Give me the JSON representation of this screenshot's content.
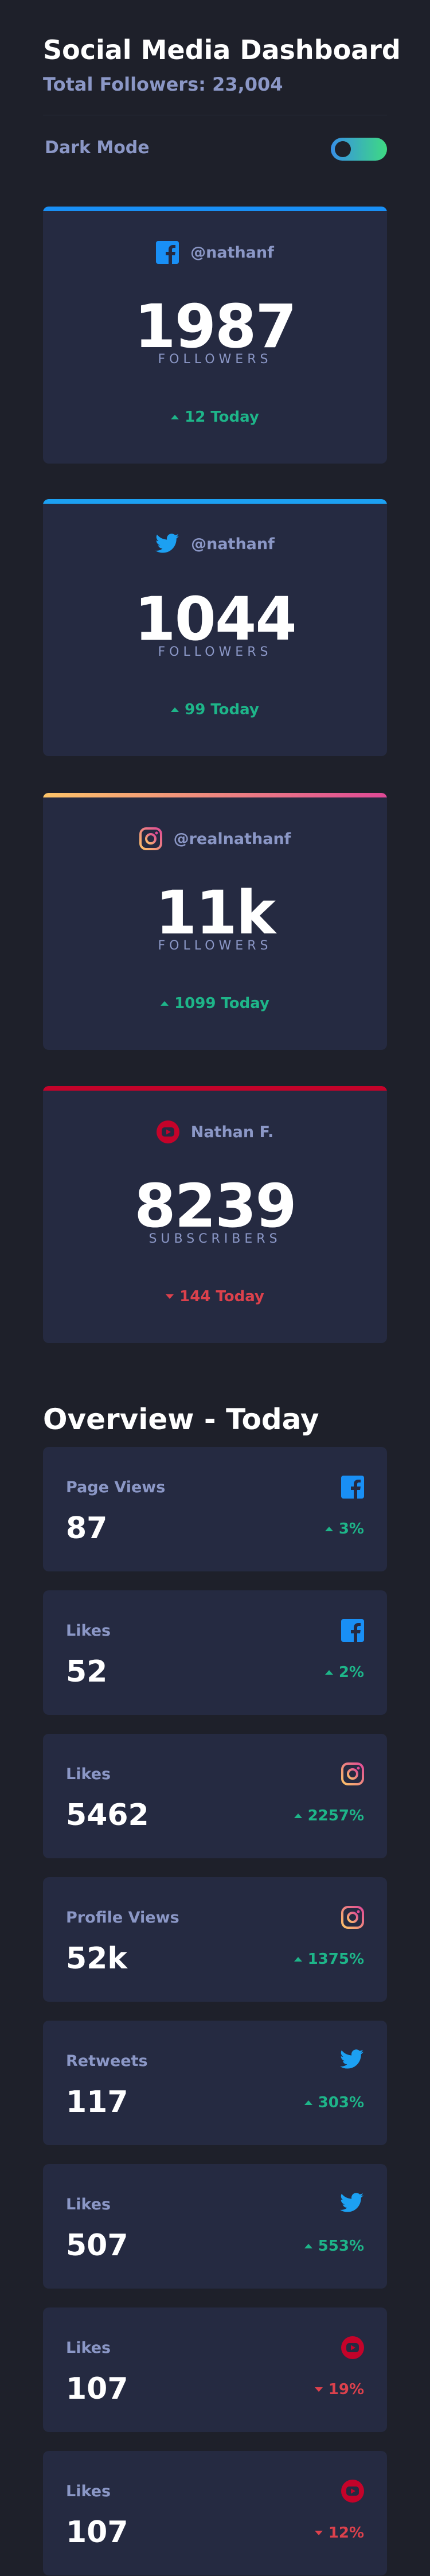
{
  "header": {
    "title": "Social Media Dashboard",
    "total_followers": "Total Followers: 23,004",
    "dark_mode_label": "Dark Mode",
    "dark_mode_on": true
  },
  "colors": {
    "facebook": "#198ff5",
    "twitter": "#1ca0f2",
    "youtube": "#c4032a",
    "up": "#1eb589",
    "down": "#dc414c"
  },
  "cards": [
    {
      "platform": "facebook",
      "icon": "facebook-icon",
      "handle": "@nathanf",
      "count": "1987",
      "unit": "FOLLOWERS",
      "trend": "up",
      "change": "12 Today"
    },
    {
      "platform": "twitter",
      "icon": "twitter-icon",
      "handle": "@nathanf",
      "count": "1044",
      "unit": "FOLLOWERS",
      "trend": "up",
      "change": "99 Today"
    },
    {
      "platform": "instagram",
      "icon": "instagram-icon",
      "handle": "@realnathanf",
      "count": "11k",
      "unit": "FOLLOWERS",
      "trend": "up",
      "change": "1099 Today"
    },
    {
      "platform": "youtube",
      "icon": "youtube-icon",
      "handle": "Nathan F.",
      "count": "8239",
      "unit": "SUBSCRIBERS",
      "trend": "down",
      "change": "144 Today"
    }
  ],
  "overview": {
    "title": "Overview - Today",
    "items": [
      {
        "label": "Page Views",
        "platform": "facebook",
        "icon": "facebook-icon",
        "value": "87",
        "trend": "up",
        "pct": "3%"
      },
      {
        "label": "Likes",
        "platform": "facebook",
        "icon": "facebook-icon",
        "value": "52",
        "trend": "up",
        "pct": "2%"
      },
      {
        "label": "Likes",
        "platform": "instagram",
        "icon": "instagram-icon",
        "value": "5462",
        "trend": "up",
        "pct": "2257%"
      },
      {
        "label": "Profile Views",
        "platform": "instagram",
        "icon": "instagram-icon",
        "value": "52k",
        "trend": "up",
        "pct": "1375%"
      },
      {
        "label": "Retweets",
        "platform": "twitter",
        "icon": "twitter-icon",
        "value": "117",
        "trend": "up",
        "pct": "303%"
      },
      {
        "label": "Likes",
        "platform": "twitter",
        "icon": "twitter-icon",
        "value": "507",
        "trend": "up",
        "pct": "553%"
      },
      {
        "label": "Likes",
        "platform": "youtube",
        "icon": "youtube-icon",
        "value": "107",
        "trend": "down",
        "pct": "19%"
      },
      {
        "label": "Likes",
        "platform": "youtube",
        "icon": "youtube-icon",
        "value": "107",
        "trend": "down",
        "pct": "12%"
      }
    ]
  }
}
